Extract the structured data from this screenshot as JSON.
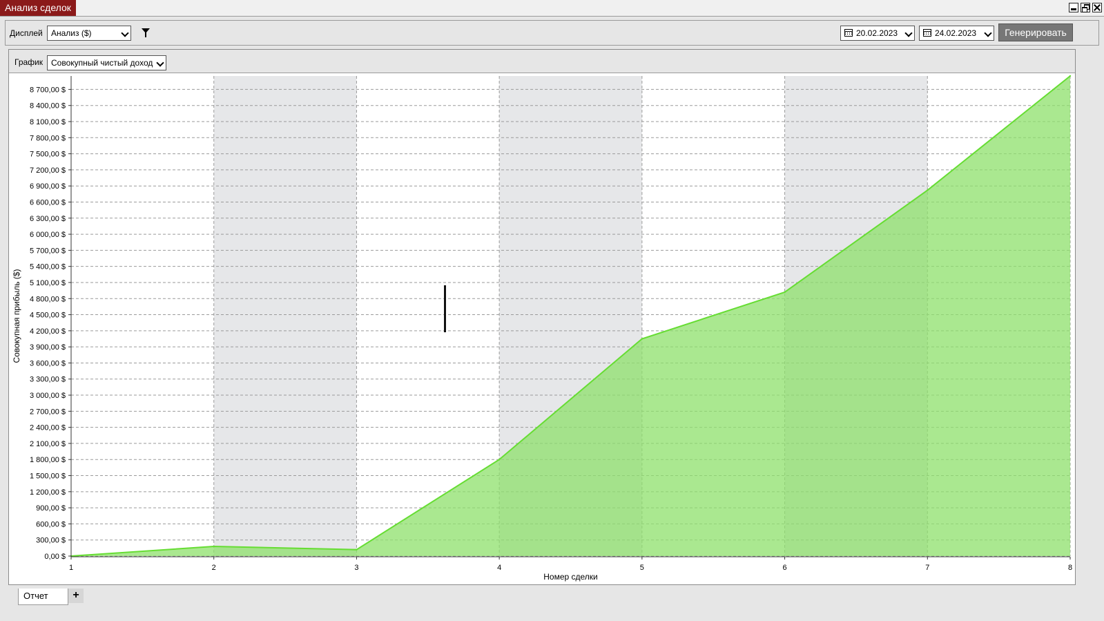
{
  "window": {
    "title": "Анализ сделок"
  },
  "toolbar": {
    "display_label": "Дисплей",
    "display_value": "Анализ ($)",
    "date_from": "20.02.2023",
    "date_to": "24.02.2023",
    "generate_label": "Генерировать"
  },
  "panel": {
    "chart_label": "График",
    "chart_value": "Совокупный чистый доход"
  },
  "tabs": {
    "report": "Отчет",
    "add": "+"
  },
  "colors": {
    "area_fill": "#8ee06b",
    "area_line": "#66dd33",
    "band": "#e6e7e9",
    "title_bg": "#8b1a1a"
  },
  "chart_data": {
    "type": "area",
    "xlabel": "Номер сделки",
    "ylabel": "Совокупная прибыль ($)",
    "x": [
      1,
      2,
      3,
      4,
      5,
      6,
      7,
      8
    ],
    "values": [
      0,
      180,
      120,
      1800,
      4050,
      4920,
      6820,
      8950
    ],
    "ylim": [
      0,
      8950
    ],
    "yticks": [
      0,
      300,
      600,
      900,
      1200,
      1500,
      1800,
      2100,
      2400,
      2700,
      3000,
      3300,
      3600,
      3900,
      4200,
      4500,
      4800,
      5100,
      5400,
      5700,
      6000,
      6300,
      6600,
      6900,
      7200,
      7500,
      7800,
      8100,
      8400,
      8700
    ],
    "ytick_labels": [
      "0,00 $",
      "300,00 $",
      "600,00 $",
      "900,00 $",
      "1 200,00 $",
      "1 500,00 $",
      "1 800,00 $",
      "2 100,00 $",
      "2 400,00 $",
      "2 700,00 $",
      "3 000,00 $",
      "3 300,00 $",
      "3 600,00 $",
      "3 900,00 $",
      "4 200,00 $",
      "4 500,00 $",
      "4 800,00 $",
      "5 100,00 $",
      "5 400,00 $",
      "5 700,00 $",
      "6 000,00 $",
      "6 300,00 $",
      "6 600,00 $",
      "6 900,00 $",
      "7 200,00 $",
      "7 500,00 $",
      "7 800,00 $",
      "8 100,00 $",
      "8 400,00 $",
      "8 700,00 $"
    ],
    "xtick_labels": [
      "1",
      "2",
      "3",
      "4",
      "5",
      "6",
      "7",
      "8"
    ],
    "grid": true
  }
}
